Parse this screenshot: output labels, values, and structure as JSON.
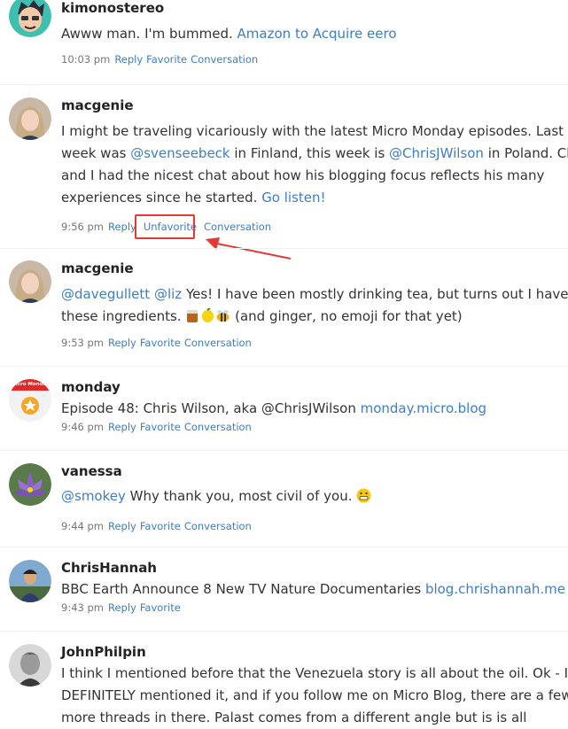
{
  "posts": [
    {
      "username": "kimonostereo",
      "text": "Awww man. I'm bummed. ",
      "link": "Amazon to Acquire eero",
      "time": "10:03 pm",
      "actions": [
        "Reply",
        "Favorite",
        "Conversation"
      ]
    },
    {
      "username": "macgenie",
      "lines": [
        [
          {
            "t": "I might be traveling vicariously with the latest Micro Monday episodes. Last"
          }
        ],
        [
          {
            "t": "week was "
          },
          {
            "l": "@svenseebeck"
          },
          {
            "t": " in Finland, this week is "
          },
          {
            "l": "@ChrisJWilson"
          },
          {
            "t": " in Poland. Chris"
          }
        ],
        [
          {
            "t": "and I had the nicest chat about how his blogging focus reflects his many"
          }
        ],
        [
          {
            "t": "experiences since he started. "
          },
          {
            "l": "Go listen!"
          }
        ]
      ],
      "time": "9:56 pm",
      "actions": [
        "Reply",
        "Unfavorite",
        "Conversation"
      ]
    },
    {
      "username": "macgenie",
      "mention1": "@davegullett",
      "mention2": "@liz",
      "text1": " Yes! I have been mostly drinking tea, but turns out I have all",
      "text2": "these ingredients. ",
      "text3": " (and ginger, no emoji for that yet)",
      "time": "9:53 pm",
      "actions": [
        "Reply",
        "Favorite",
        "Conversation"
      ]
    },
    {
      "username": "monday",
      "avatar_label": "Micro Monday",
      "text": "Episode 48: Chris Wilson, aka @ChrisJWilson ",
      "link": "monday.micro.blog",
      "time": "9:46 pm",
      "actions": [
        "Reply",
        "Favorite",
        "Conversation"
      ]
    },
    {
      "username": "vanessa",
      "mention": "@smokey",
      "text": " Why thank you, most civil of you. ",
      "time": "9:44 pm",
      "actions": [
        "Reply",
        "Favorite",
        "Conversation"
      ]
    },
    {
      "username": "ChrisHannah",
      "text": "BBC Earth Announce 8 New TV Nature Documentaries ",
      "link": "blog.chrishannah.me",
      "time": "9:43 pm",
      "actions": [
        "Reply",
        "Favorite"
      ]
    },
    {
      "username": "JohnPhilpin",
      "lines": [
        "I think I mentioned before that the Venezuela story is all about the oil. Ok - I",
        "DEFINITELY mentioned it, and if you follow me on Micro Blog, there are a few",
        "more threads in there. Palast comes from a different angle but is is all"
      ]
    }
  ],
  "colors": {
    "link": "#3d7ec6",
    "highlight": "#e53935",
    "username": "#222222"
  }
}
